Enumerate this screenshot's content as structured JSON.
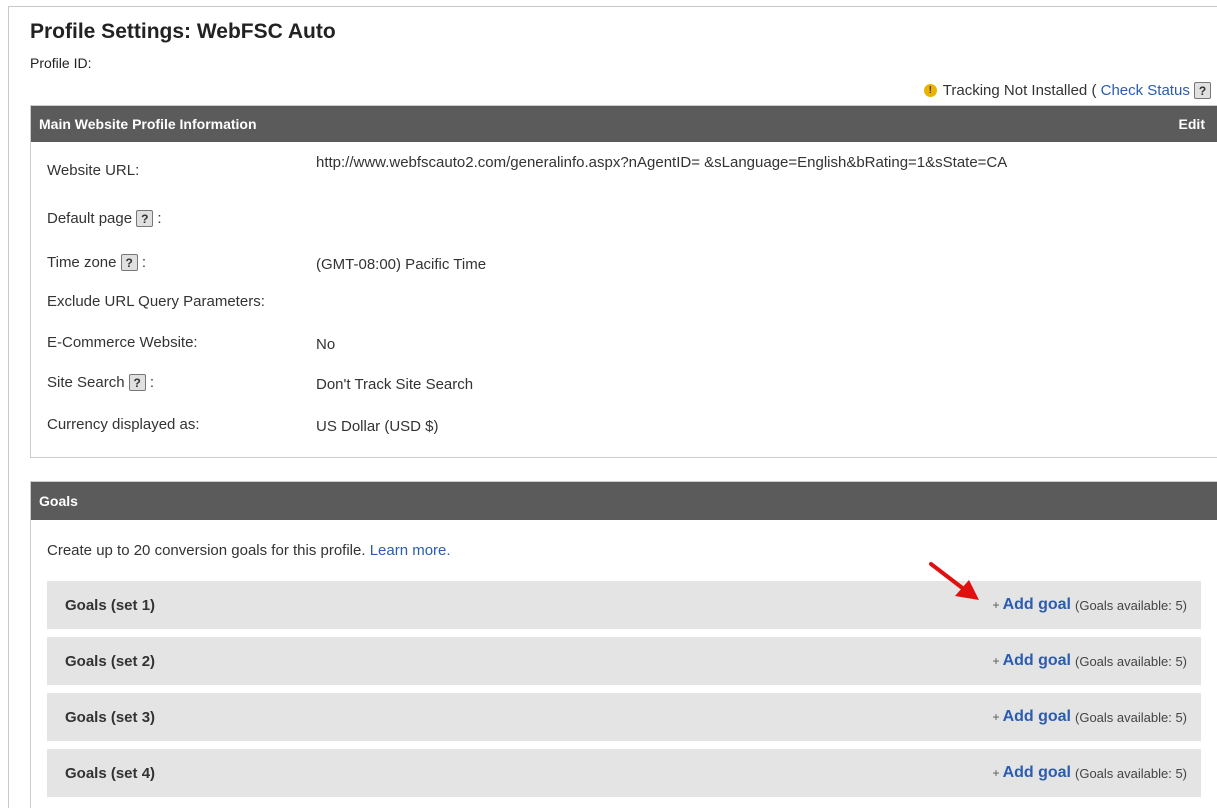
{
  "header": {
    "title": "Profile Settings: WebFSC Auto",
    "profile_id_label": "Profile ID:"
  },
  "tracking": {
    "status_text": "Tracking Not Installed (",
    "check_status_label": "Check Status",
    "help_glyph": "?"
  },
  "main_info": {
    "heading": "Main Website Profile Information",
    "edit_label": "Edit",
    "rows": [
      {
        "label": "Website URL:",
        "value": "http://www.webfscauto2.com/generalinfo.aspx?nAgentID=  &sLanguage=English&bRating=1&sState=CA"
      },
      {
        "label": "Default page",
        "suffix": ":",
        "value": ""
      },
      {
        "label": "Time zone",
        "suffix": ":",
        "value": "(GMT-08:00) Pacific Time"
      },
      {
        "label": "Exclude URL Query Parameters:",
        "value": ""
      },
      {
        "label": "E-Commerce Website:",
        "value": "No"
      },
      {
        "label": "Site Search",
        "suffix": ":",
        "value": "Don't Track Site Search"
      },
      {
        "label": "Currency displayed as:",
        "value": "US Dollar (USD $)"
      }
    ]
  },
  "goals": {
    "heading": "Goals",
    "intro_text": "Create up to 20 conversion goals for this profile.",
    "learn_more_label": "Learn more.",
    "add_goal_label": "Add goal",
    "plus_glyph": "+",
    "sets": [
      {
        "name": "Goals (set 1)",
        "available": "(Goals available: 5)"
      },
      {
        "name": "Goals (set 2)",
        "available": "(Goals available: 5)"
      },
      {
        "name": "Goals (set 3)",
        "available": "(Goals available: 5)"
      },
      {
        "name": "Goals (set 4)",
        "available": "(Goals available: 5)"
      }
    ]
  },
  "colors": {
    "header_bar": "#5b5b5b",
    "goal_row_bg": "#e4e4e4",
    "link": "#2a5db0",
    "arrow": "#e01010"
  }
}
